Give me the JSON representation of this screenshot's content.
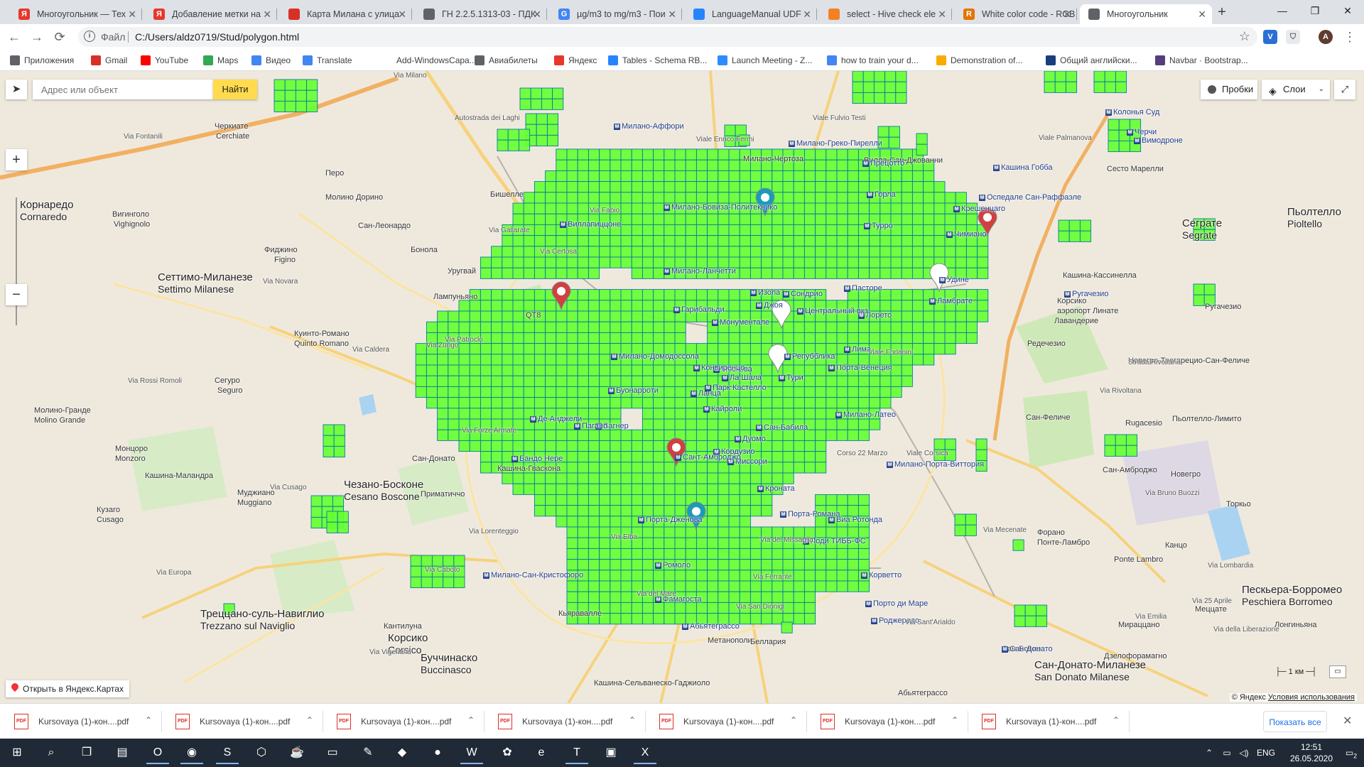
{
  "browser": {
    "tabs": [
      {
        "title": "Многоугольник — Тех",
        "icon": "yandex-icon",
        "color": "#e8362b"
      },
      {
        "title": "Добавление метки на",
        "icon": "yandex-icon",
        "color": "#e8362b"
      },
      {
        "title": "Карта Милана с улица",
        "icon": "map-pin-icon",
        "color": "#d93025"
      },
      {
        "title": "ГН 2.2.5.1313-03 - ПДК",
        "icon": "globe-icon",
        "color": "#5f6368"
      },
      {
        "title": "µg/m3 to mg/m3 - Пои",
        "icon": "google-icon",
        "color": "#4285f4"
      },
      {
        "title": "LanguageManual UDF",
        "icon": "confluence-icon",
        "color": "#2684ff"
      },
      {
        "title": "select - Hive check ele",
        "icon": "stackoverflow-icon",
        "color": "#f48024"
      },
      {
        "title": "White color code - RGB",
        "icon": "r-icon",
        "color": "#e37400"
      },
      {
        "title": "Многоугольник",
        "icon": "globe-icon",
        "color": "#5f6368"
      }
    ],
    "active_tab_index": 8,
    "new_tab": "+",
    "window_controls": {
      "minimize": "—",
      "maximize": "❐",
      "close": "✕"
    },
    "nav": {
      "back": "←",
      "forward": "→",
      "reload": "⟳"
    },
    "address": {
      "protocol": "Файл",
      "url": "C:/Users/aldz0719/Stud/polygon.html",
      "info": "i"
    },
    "profile_initial": "A",
    "bookmarks": [
      {
        "label": "Приложения",
        "icon": "apps-icon",
        "color": "#5f6368"
      },
      {
        "label": "Gmail",
        "icon": "gmail-icon",
        "color": "#d93025"
      },
      {
        "label": "YouTube",
        "icon": "youtube-icon",
        "color": "#ff0000"
      },
      {
        "label": "Maps",
        "icon": "maps-icon",
        "color": "#34a853"
      },
      {
        "label": "Видео",
        "icon": "google-icon",
        "color": "#4285f4"
      },
      {
        "label": "Translate",
        "icon": "translate-icon",
        "color": "#4285f4"
      },
      {
        "label": "Add-WindowsCapa...",
        "icon": "blank-icon",
        "color": "#ffffff"
      },
      {
        "label": "Авиабилеты",
        "icon": "globe-icon",
        "color": "#5f6368"
      },
      {
        "label": "Яндекс",
        "icon": "yandex-icon",
        "color": "#e8362b"
      },
      {
        "label": "Tables - Schema RB...",
        "icon": "confluence-icon",
        "color": "#2684ff"
      },
      {
        "label": "Launch Meeting - Z...",
        "icon": "zoom-icon",
        "color": "#2d8cff"
      },
      {
        "label": "how to train your d...",
        "icon": "google-icon",
        "color": "#4285f4"
      },
      {
        "label": "Demonstration of...",
        "icon": "chart-icon",
        "color": "#f9ab00"
      },
      {
        "label": "Общий английски...",
        "icon": "h-icon",
        "color": "#1a3d7c"
      },
      {
        "label": "Navbar · Bootstrap...",
        "icon": "bootstrap-icon",
        "color": "#563d7c"
      }
    ]
  },
  "map": {
    "search_placeholder": "Адрес или объект",
    "find_button": "Найти",
    "traffic_button": "Пробки",
    "layers_button": "Слои",
    "zoom_in": "+",
    "zoom_out": "−",
    "open_in_yandex": "Открыть в Яндекс.Картах",
    "scale_label": "1 км",
    "copyright": "© Яндекс",
    "terms": "Условия использования",
    "polygon_fill": "#66ff33",
    "polygon_stroke": "#0a7a9a",
    "cities": [
      {
        "ru": "Корнаредо",
        "lat": "Cornaredo"
      },
      {
        "ru": "Сеттимо-Миланезе",
        "lat": "Settimo Milanese"
      },
      {
        "ru": "Чезано-Босконе",
        "lat": "Cesano Boscone"
      },
      {
        "ru": "Треццано-суль-Навиглио",
        "lat": "Trezzano sul Naviglio"
      },
      {
        "ru": "Буччинаско",
        "lat": "Buccinasco"
      },
      {
        "ru": "Корсико",
        "lat": "Corsico"
      },
      {
        "ru": "Сеграте",
        "lat": "Segrate"
      },
      {
        "ru": "Пьолтелло",
        "lat": "Pioltello"
      },
      {
        "ru": "Пескьера-Борромео",
        "lat": "Peschiera Borromeo"
      },
      {
        "ru": "Сан-Донато-Миланезе",
        "lat": "San Donato Milanese"
      }
    ],
    "places": [
      "Черкиате",
      "Cerchiate",
      "Перо",
      "Молино Дорино",
      "Сан-Леонардо",
      "Вигинголо",
      "Vighignolo",
      "Фиджино",
      "Figino",
      "Уругвай",
      "Бонола",
      "Лампуньяно",
      "QT8",
      "Куинто-Романо",
      "Quinto Romano",
      "Сегуро",
      "Seguro",
      "Молино-Гранде",
      "Molino Grande",
      "Монцоро",
      "Monzoro",
      "Кашина-Маландра",
      "Муджиано",
      "Muggiano",
      "Кузаго",
      "Cusago",
      "Кашина-Гваскона",
      "Приматиччо",
      "Бишелле",
      "Милано-Чертоза",
      "Вилла-Сан-Джованни",
      "Сесто Марелли",
      "Кашина-Кассинелла",
      "Лавандерие",
      "Редечезио",
      "Новегро-Трегарецио-Сан-Феличе",
      "Сан-Феличе",
      "Новегро",
      "Торкьо",
      "Форано",
      "Понте-Ламбро",
      "Ponte Lambro",
      "Канцо",
      "Меццате",
      "Мираццано",
      "Дзелофорамагно",
      "Метанополи",
      "Беллария",
      "Абьятеграссо",
      "Кашина-Сельванеско-Гаджиоло",
      "Кьяравалле",
      "Кантилуна",
      "Сан-Амброджо",
      "Корсико",
      "аэропорт Линате",
      "Ругачезио",
      "Rugacesio",
      "Пьолтелло-Лимито",
      "Лонгиньяна",
      "Сан-Бовио",
      "Сан-Донато"
    ],
    "metro_labels": [
      "Милано-Аффори",
      "Милано-Бовиза-Политекнико",
      "Виллапиццоне",
      "Милано-Домодоссола",
      "Буонарроти",
      "Вагнер",
      "Де Анджели",
      "Пагано",
      "Бандо Нере",
      "Милано-Ланчетти",
      "Монументале",
      "Гарибальди",
      "Москова",
      "Ланца",
      "Кайроли",
      "Дуомо",
      "Кордузио",
      "Сан-Бабила",
      "Миссори",
      "Кроната",
      "Порта-Романа",
      "Лоди ТИББ-ФС",
      "Порто ди Маре",
      "Роджередо",
      "Корветто",
      "Порта-Венеция",
      "Лима",
      "Лорето",
      "Пасторе",
      "Турро",
      "Горла",
      "Прецотто",
      "Милано-Греко-Пирелли",
      "Крешенцаго",
      "Ламбрате",
      "Удине",
      "Чимиано",
      "Милано-Латео",
      "Милано-Порта-Виттория",
      "Центральный вкз.",
      "Сондрио",
      "Изола",
      "Джоя",
      "Репубблика",
      "Тури",
      "Конвиренцо",
      "Парк Кастелло",
      "Милано-Сан-Кристофоро",
      "Фамагоста",
      "Ромоло",
      "Порта-Дженова",
      "Сант-Амброджо",
      "Ла Шала",
      "Виа Ротонда",
      "Абьятеграссо",
      "Кашина Гобба",
      "Оспедале Сан-Раффаэле",
      "Вимодроне",
      "Колонья Суд",
      "Черчи",
      "Сан-Донато",
      "Ругачезио"
    ],
    "streets": [
      "Via Milano",
      "Autostrada dei Laghi",
      "Via Fontanili",
      "Via Novara",
      "Via Rossi Romoli",
      "Via Cusago",
      "Via Lorenteggio",
      "Via dei Missaglia",
      "Via Ferrante",
      "Viale Enrico Fermi",
      "Viale Fulvio Testi",
      "Viale Palmanova",
      "Via Rivoltana",
      "Strada Rivoltana",
      "Via Mecenate",
      "Via Emilia",
      "Via della Liberazione",
      "Via Vigentina",
      "Via del Mare",
      "Via Gallarate",
      "Via Certosa",
      "Via Patroclo",
      "Via Caldera",
      "Via Caboto",
      "Via Fabio",
      "Via Zurigo",
      "Via Elba",
      "Via Forze Armate",
      "Viale Forlanini",
      "Corso 22 Marzo",
      "Viale Corsica",
      "Via Sant'Arialdo",
      "Via San Dionigi",
      "Via Lombardia",
      "Via Bruno Buozzi",
      "Via 25 Aprile",
      "Via Europa"
    ]
  },
  "downloads": {
    "items": [
      "Kursovaya (1)-кон....pdf",
      "Kursovaya (1)-кон....pdf",
      "Kursovaya (1)-кон....pdf",
      "Kursovaya (1)-кон....pdf",
      "Kursovaya (1)-кон....pdf",
      "Kursovaya (1)-кон....pdf",
      "Kursovaya (1)-кон....pdf"
    ],
    "pdf_badge": "PDF",
    "show_all": "Показать все",
    "close": "✕"
  },
  "taskbar": {
    "apps": [
      {
        "name": "windows-start-icon",
        "glyph": "⊞"
      },
      {
        "name": "search-icon",
        "glyph": "⌕"
      },
      {
        "name": "task-view-icon",
        "glyph": "❐"
      },
      {
        "name": "file-explorer-icon",
        "glyph": "▤"
      },
      {
        "name": "outlook-icon",
        "glyph": "O"
      },
      {
        "name": "chrome-icon",
        "glyph": "◉"
      },
      {
        "name": "skype-icon",
        "glyph": "S"
      },
      {
        "name": "3d-viewer-icon",
        "glyph": "⬡"
      },
      {
        "name": "java-icon",
        "glyph": "☕"
      },
      {
        "name": "terminal-icon",
        "glyph": "▭"
      },
      {
        "name": "notepad-icon",
        "glyph": "✎"
      },
      {
        "name": "git-icon",
        "glyph": "◆"
      },
      {
        "name": "zoom-icon",
        "glyph": "●"
      },
      {
        "name": "word-icon",
        "glyph": "W"
      },
      {
        "name": "paint-icon",
        "glyph": "✿"
      },
      {
        "name": "edge-icon",
        "glyph": "e"
      },
      {
        "name": "teams-icon",
        "glyph": "T"
      },
      {
        "name": "remote-desktop-icon",
        "glyph": "▣"
      },
      {
        "name": "excel-icon",
        "glyph": "X"
      }
    ],
    "lang": "ENG",
    "time": "12:51",
    "date": "26.05.2020",
    "notif_count": "2"
  }
}
